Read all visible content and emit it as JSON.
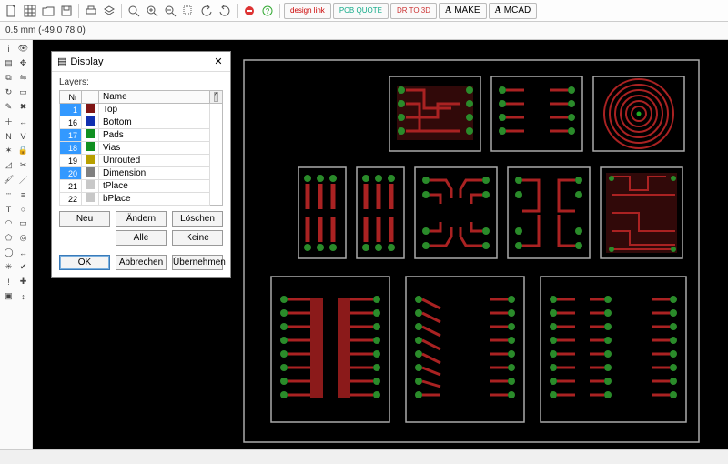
{
  "toolbar": {
    "buttons_left": [
      "doc",
      "open",
      "save",
      "print",
      "layer",
      "grid",
      "zoom-fit",
      "zoom-in",
      "zoom-out",
      "zoom-sel",
      "hand",
      "undo",
      "redo",
      "stop",
      "help"
    ],
    "label_buttons": [
      {
        "key": "design-link",
        "label": "design\nlink",
        "color": "#c00"
      },
      {
        "key": "pcb-quote",
        "label": "PCB\nQUOTE",
        "color": "#1a8"
      },
      {
        "key": "dr-to-3d",
        "label": "DR\nTO 3D",
        "color": "#c33"
      },
      {
        "key": "make",
        "label": "MAKE",
        "prefix": "A"
      },
      {
        "key": "mcad",
        "label": "MCAD",
        "prefix": "A"
      }
    ]
  },
  "status": {
    "text": "0.5 mm (-49.0 78.0)"
  },
  "palette": {
    "tools": [
      "info",
      "eye",
      "layer",
      "move",
      "copy",
      "mirror",
      "rotate",
      "group",
      "edit",
      "delete",
      "add",
      "replace",
      "name",
      "value",
      "smash",
      "lock",
      "miter",
      "split",
      "paint",
      "line",
      "dline",
      "wire",
      "text",
      "circle",
      "arc",
      "rect",
      "poly",
      "via",
      "hole",
      "dim",
      "ratsnest",
      "drc",
      "errors",
      "mark",
      "sel",
      "meas"
    ]
  },
  "dialog": {
    "title": "Display",
    "layers_label": "Layers:",
    "headers": {
      "nr": "Nr",
      "name": "Name"
    },
    "rows": [
      {
        "nr": "1",
        "color": "#801515",
        "name": "Top",
        "sel": true
      },
      {
        "nr": "16",
        "color": "#1030b0",
        "name": "Bottom"
      },
      {
        "nr": "17",
        "color": "#109020",
        "name": "Pads",
        "sel": true
      },
      {
        "nr": "18",
        "color": "#109020",
        "name": "Vias",
        "sel": true
      },
      {
        "nr": "19",
        "color": "#b8a000",
        "name": "Unrouted"
      },
      {
        "nr": "20",
        "color": "#808080",
        "name": "Dimension",
        "sel": true
      },
      {
        "nr": "21",
        "color": "#c8c8c8",
        "name": "tPlace"
      },
      {
        "nr": "22",
        "color": "#c8c8c8",
        "name": "bPlace"
      }
    ],
    "buttons": {
      "neu": "Neu",
      "aendern": "Ändern",
      "loeschen": "Löschen",
      "alle": "Alle",
      "keine": "Keine",
      "ok": "OK",
      "abbrechen": "Abbrechen",
      "uebernehmen": "Übernehmen"
    }
  }
}
